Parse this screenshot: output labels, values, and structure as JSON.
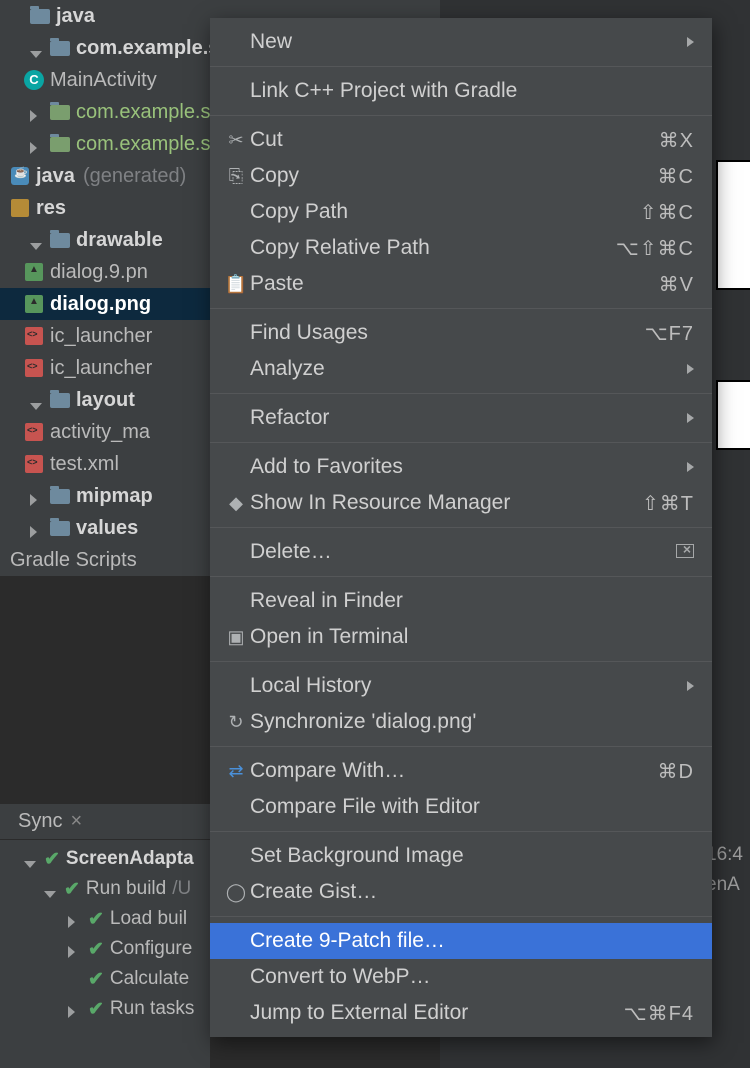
{
  "tree": {
    "java": "java",
    "pkg_app": "com.example.s",
    "main_activity": "MainActivity",
    "pkg_test1": "com.example.s",
    "pkg_test2": "com.example.s",
    "java_gen": "java",
    "gen_suffix": "(generated)",
    "res": "res",
    "drawable": "drawable",
    "dialog9": "dialog.9.pn",
    "dialogpng": "dialog.png",
    "ic1": "ic_launcher",
    "ic2": "ic_launcher",
    "layout": "layout",
    "act_main": "activity_ma",
    "testxml": "test.xml",
    "mipmap": "mipmap",
    "values": "values",
    "gradle_scripts": "Gradle Scripts"
  },
  "sync_tab": "Sync",
  "build": {
    "root": "ScreenAdapta",
    "run_build": "Run build",
    "run_build_path": "/U",
    "load": "Load buil",
    "configure": "Configure",
    "calculate": "Calculate",
    "run_tasks": "Run tasks",
    "t1": "16:4",
    "t2": "enA"
  },
  "menu": {
    "new": "New",
    "link_cpp": "Link C++ Project with Gradle",
    "cut": "Cut",
    "cut_k": "⌘X",
    "copy": "Copy",
    "copy_k": "⌘C",
    "copy_path": "Copy Path",
    "copy_path_k": "⇧⌘C",
    "copy_rel": "Copy Relative Path",
    "copy_rel_k": "⌥⇧⌘C",
    "paste": "Paste",
    "paste_k": "⌘V",
    "find_usages": "Find Usages",
    "find_usages_k": "⌥F7",
    "analyze": "Analyze",
    "refactor": "Refactor",
    "fav": "Add to Favorites",
    "res_mgr": "Show In Resource Manager",
    "res_mgr_k": "⇧⌘T",
    "delete": "Delete…",
    "reveal": "Reveal in Finder",
    "terminal": "Open in Terminal",
    "local_hist": "Local History",
    "sync": "Synchronize 'dialog.png'",
    "compare_with": "Compare With…",
    "compare_with_k": "⌘D",
    "compare_ed": "Compare File with Editor",
    "bgimg": "Set Background Image",
    "gist": "Create Gist…",
    "ninepatch": "Create 9-Patch file…",
    "webp": "Convert to WebP…",
    "ext_editor": "Jump to External Editor",
    "ext_editor_k": "⌥⌘F4"
  }
}
